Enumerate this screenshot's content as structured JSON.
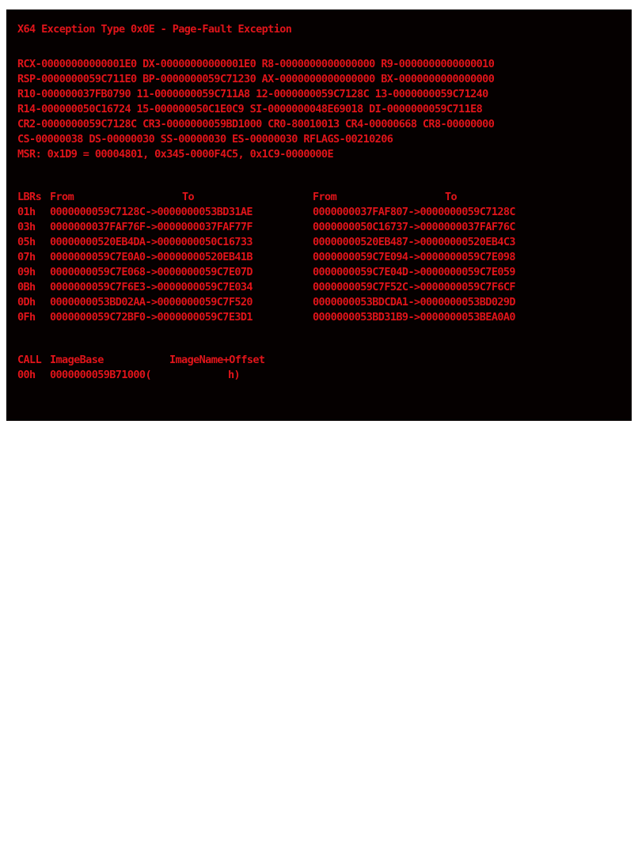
{
  "theme": {
    "background": "#050000",
    "text": "#e0141a"
  },
  "title": "X64 Exception Type 0x0E - Page-Fault Exception",
  "registers": [
    "RCX-00000000000001E0 DX-00000000000001E0 R8-0000000000000000 R9-0000000000000010",
    "RSP-0000000059C711E0 BP-0000000059C71230 AX-0000000000000000 BX-0000000000000000",
    "R10-000000037FB0790 11-0000000059C711A8 12-0000000059C7128C 13-0000000059C71240",
    "R14-000000050C16724 15-000000050C1E0C9 SI-0000000048E69018 DI-0000000059C711E8",
    "CR2-0000000059C7128C CR3-0000000059BD1000 CR0-80010013 CR4-00000668 CR8-00000000",
    "CS-00000038 DS-00000030 SS-00000030 ES-00000030 RFLAGS-00210206",
    "MSR: 0x1D9 = 00004801, 0x345-0000F4C5, 0x1C9-0000000E"
  ],
  "lbr": {
    "headers": [
      "LBRs",
      "From",
      "To",
      "From",
      "To"
    ],
    "rows": [
      {
        "idx": "01h",
        "a": "0000000059C7128C->0000000053BD31AE",
        "b": "0000000037FAF807->0000000059C7128C"
      },
      {
        "idx": "03h",
        "a": "0000000037FAF76F->0000000037FAF77F",
        "b": "0000000050C16737->0000000037FAF76C"
      },
      {
        "idx": "05h",
        "a": "00000000520EB4DA->0000000050C16733",
        "b": "00000000520EB487->00000000520EB4C3"
      },
      {
        "idx": "07h",
        "a": "0000000059C7E0A0->00000000520EB41B",
        "b": "0000000059C7E094->0000000059C7E098"
      },
      {
        "idx": "09h",
        "a": "0000000059C7E068->0000000059C7E07D",
        "b": "0000000059C7E04D->0000000059C7E059"
      },
      {
        "idx": "0Bh",
        "a": "0000000059C7F6E3->0000000059C7E034",
        "b": "0000000059C7F52C->0000000059C7F6CF"
      },
      {
        "idx": "0Dh",
        "a": "0000000053BD02AA->0000000059C7F520",
        "b": "0000000053BDCDA1->0000000053BD029D"
      },
      {
        "idx": "0Fh",
        "a": "0000000059C72BF0->0000000059C7E3D1",
        "b": "0000000053BD31B9->0000000053BEA0A0"
      }
    ]
  },
  "callstack": {
    "headers": [
      "CALL",
      "ImageBase",
      "ImageName+Offset"
    ],
    "rows": [
      {
        "idx": "00h",
        "base": "0000000059B71000(",
        "name": "h)"
      }
    ]
  }
}
